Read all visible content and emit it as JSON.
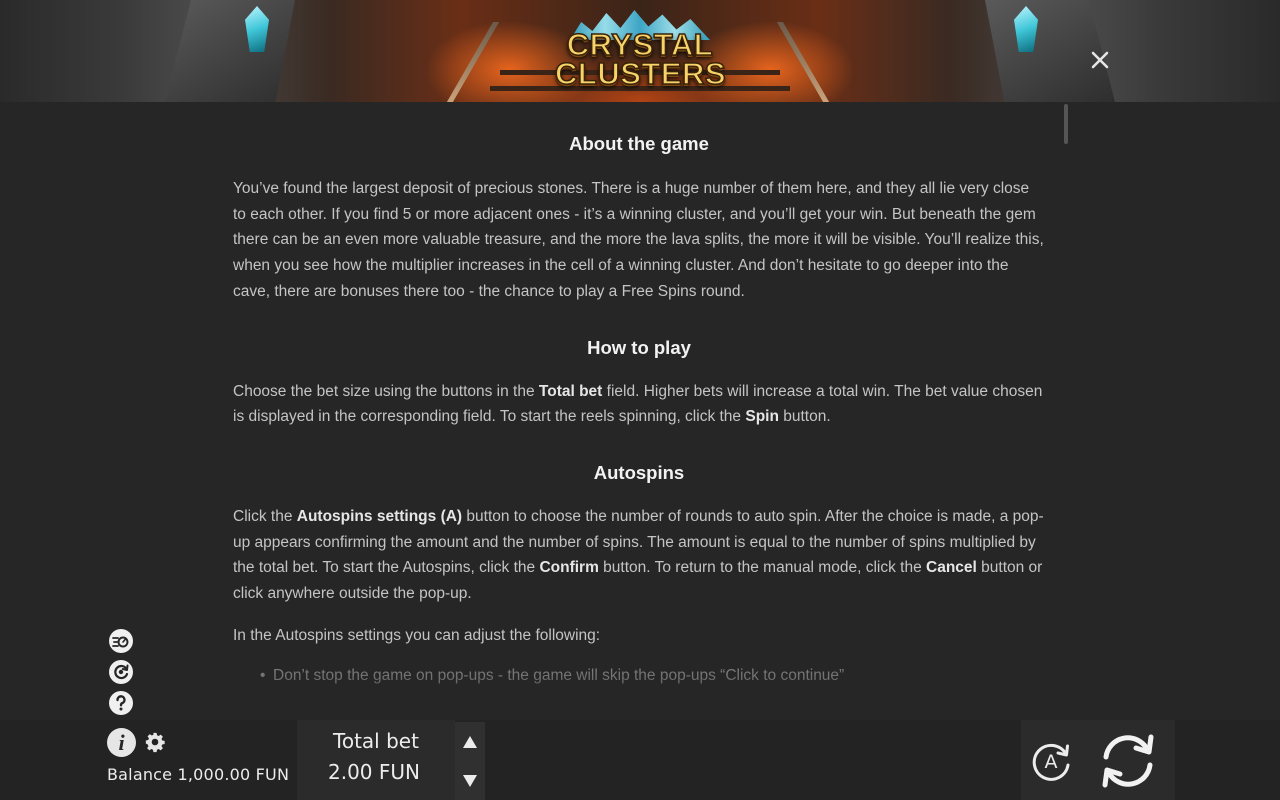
{
  "header": {
    "logo_line1": "CRYSTAL",
    "logo_line2": "CLUSTERS",
    "close_icon": "close-icon"
  },
  "content": {
    "about_title": "About the game",
    "about_text": "You’ve found the largest deposit of precious stones. There is a huge number of them here, and they all lie very close to each other. If you find 5 or more adjacent ones - it’s a winning cluster, and you’ll get your win. But beneath the gem there can be an even more valuable treasure, and the more the lava splits, the more it will be visible. You’ll realize this, when you see how the multiplier increases in the cell of a winning cluster. And don’t hesitate to go deeper into the cave, there are bonuses there too - the chance to play a Free Spins round.",
    "howto_title": "How to play",
    "howto_p1": "Choose the bet size using the buttons in the ",
    "howto_b1": "Total bet",
    "howto_p2": " field. Higher bets will increase a total win. The bet value chosen is displayed in the corresponding field. To start the reels spinning, click the ",
    "howto_b2": "Spin",
    "howto_p3": " button.",
    "auto_title": "Autospins",
    "auto_p1": "Click the ",
    "auto_b1": "Autospins settings (A)",
    "auto_p2": " button to choose the number of rounds to auto spin. After the choice is made, a pop-up appears confirming the amount and the number of spins. The amount is equal to the number of spins multiplied by the total bet. To start the Autospins, click the ",
    "auto_b2": "Confirm",
    "auto_p3": " button. To return to the manual mode, click the ",
    "auto_b3": "Cancel",
    "auto_p4": " button or click anywhere outside the pop-up.",
    "auto_settings_intro": "In the Autospins settings you can adjust the following:",
    "bullet_1": "Don’t stop the game on pop-ups - the game will skip the pop-ups “Click to continue”"
  },
  "side_icons": [
    "turbo-icon",
    "quick-spin-icon",
    "help-icon"
  ],
  "bottom_bar": {
    "info_glyph": "i",
    "balance_label": "Balance",
    "balance_value": "1,000.00 FUN",
    "total_bet_label": "Total bet",
    "total_bet_value": "2.00 FUN",
    "auto_label": "A"
  },
  "colors": {
    "background": "#262626",
    "bar": "#232323",
    "text": "#c4c4c4",
    "heading": "#f2f2f2",
    "logo_gold": "#f7d36a",
    "crystal": "#3ec6d8"
  }
}
